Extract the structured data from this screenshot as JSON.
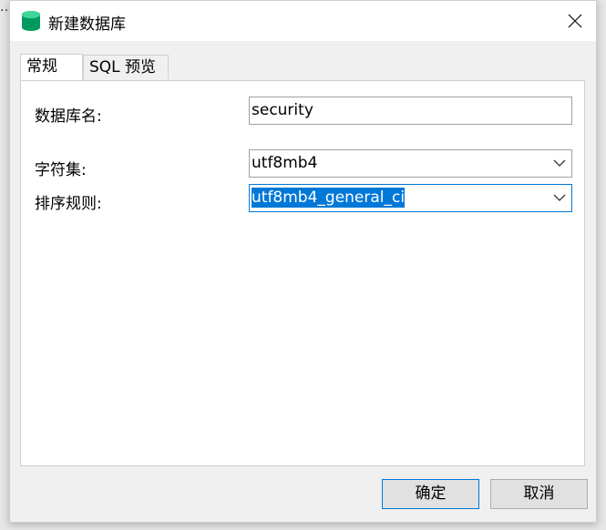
{
  "dialog": {
    "title": "新建数据库",
    "close_symbol": "✕"
  },
  "tabs": [
    {
      "label": "常规",
      "active": true
    },
    {
      "label": "SQL 预览",
      "active": false
    }
  ],
  "form": {
    "db_name_label": "数据库名:",
    "db_name_value": "security",
    "charset_label": "字符集:",
    "charset_value": "utf8mb4",
    "collation_label": "排序规则:",
    "collation_value": "utf8mb4_general_ci"
  },
  "buttons": {
    "ok_label": "确定",
    "cancel_label": "取消"
  },
  "colors": {
    "accent": "#0078d7",
    "db_icon": "#00a86b"
  }
}
